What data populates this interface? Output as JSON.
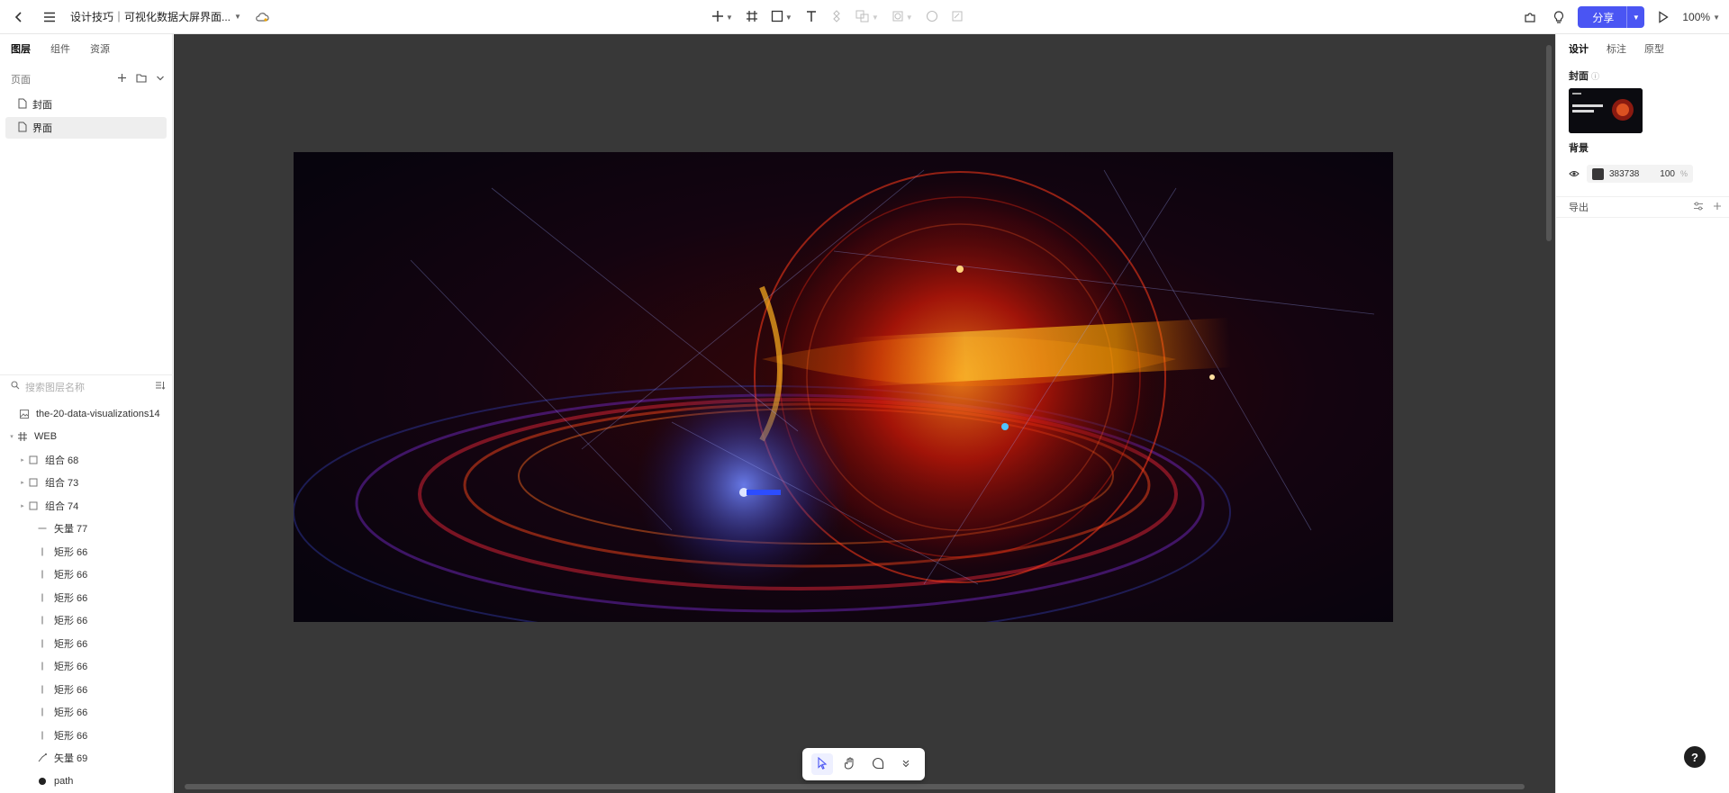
{
  "topbar": {
    "doc_title": "设计技巧｜可视化数据大屏界面...",
    "share_label": "分享",
    "zoom_label": "100%"
  },
  "left_panel": {
    "tabs": [
      {
        "label": "图层",
        "active": true
      },
      {
        "label": "组件",
        "active": false
      },
      {
        "label": "资源",
        "active": false
      }
    ],
    "pages_header": "页面",
    "pages": [
      {
        "label": "封面",
        "active": false
      },
      {
        "label": "界面",
        "active": true
      }
    ],
    "search_placeholder": "搜索图层名称",
    "layers": [
      {
        "label": "the-20-data-visualizations14",
        "icon": "image-icon",
        "indent": 1,
        "expandable": false
      },
      {
        "label": "WEB",
        "icon": "frame-icon",
        "indent": 0,
        "expandable": true
      },
      {
        "label": "组合 68",
        "icon": "group-icon",
        "indent": 1,
        "expandable": true
      },
      {
        "label": "组合 73",
        "icon": "group-icon",
        "indent": 1,
        "expandable": true
      },
      {
        "label": "组合 74",
        "icon": "group-icon",
        "indent": 1,
        "expandable": true
      },
      {
        "label": "矢量 77",
        "icon": "line-icon",
        "indent": 2,
        "expandable": false
      },
      {
        "label": "矩形 66",
        "icon": "rect-bar-icon",
        "indent": 2,
        "expandable": false
      },
      {
        "label": "矩形 66",
        "icon": "rect-bar-icon",
        "indent": 2,
        "expandable": false
      },
      {
        "label": "矩形 66",
        "icon": "rect-bar-icon",
        "indent": 2,
        "expandable": false
      },
      {
        "label": "矩形 66",
        "icon": "rect-bar-icon",
        "indent": 2,
        "expandable": false
      },
      {
        "label": "矩形 66",
        "icon": "rect-bar-icon",
        "indent": 2,
        "expandable": false
      },
      {
        "label": "矩形 66",
        "icon": "rect-bar-icon",
        "indent": 2,
        "expandable": false
      },
      {
        "label": "矩形 66",
        "icon": "rect-bar-icon",
        "indent": 2,
        "expandable": false
      },
      {
        "label": "矩形 66",
        "icon": "rect-bar-icon",
        "indent": 2,
        "expandable": false
      },
      {
        "label": "矩形 66",
        "icon": "rect-bar-icon",
        "indent": 2,
        "expandable": false
      },
      {
        "label": "矢量 69",
        "icon": "vector-icon",
        "indent": 2,
        "expandable": false
      },
      {
        "label": "path",
        "icon": "path-icon",
        "indent": 2,
        "expandable": false
      }
    ]
  },
  "right_panel": {
    "tabs": [
      {
        "label": "设计",
        "active": true
      },
      {
        "label": "标注",
        "active": false
      },
      {
        "label": "原型",
        "active": false
      }
    ],
    "cover_label": "封面",
    "background_label": "背景",
    "background_hex": "383738",
    "background_opacity": "100",
    "percent_sign": "%",
    "export_label": "导出"
  },
  "colors": {
    "canvas_bg": "#383838",
    "accent": "#4a55f3"
  }
}
